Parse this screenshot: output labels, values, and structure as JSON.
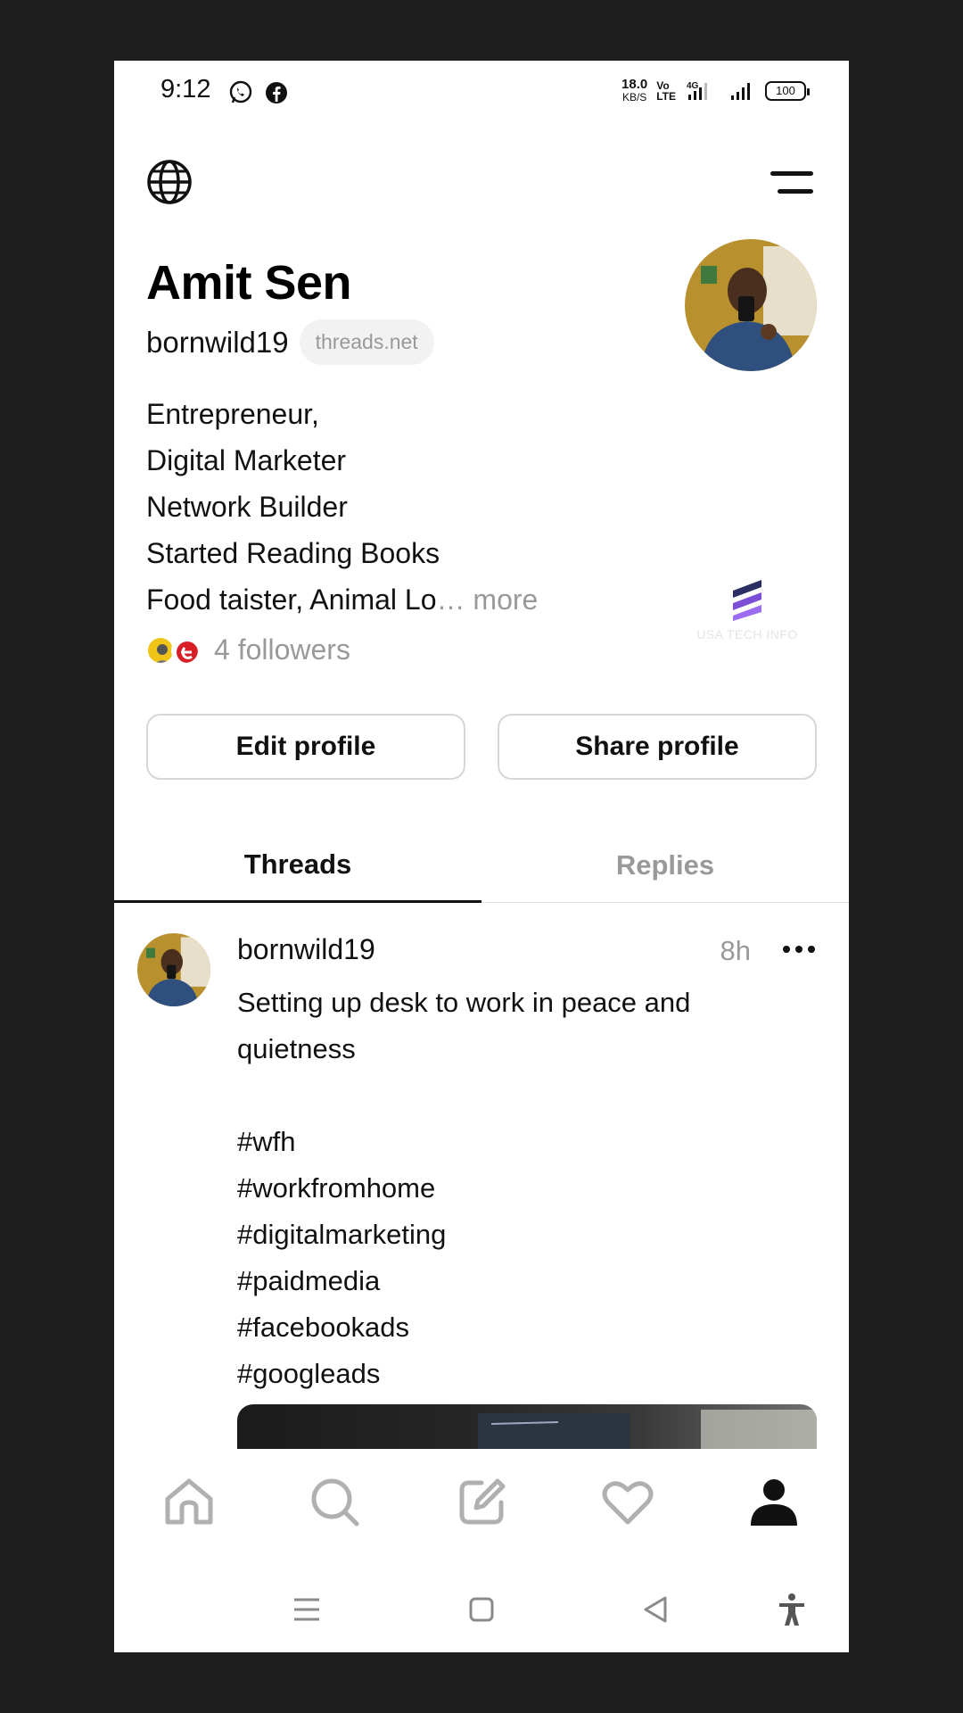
{
  "status_bar": {
    "time": "9:12",
    "net_speed": "18.0",
    "net_unit": "KB/S",
    "volte": "Vo",
    "volte2": "LTE",
    "network": "4G",
    "battery": "100"
  },
  "profile": {
    "name": "Amit Sen",
    "username": "bornwild19",
    "domain_chip": "threads.net",
    "bio_lines": [
      "Entrepreneur,",
      "Digital Marketer",
      "Network Builder",
      "Started Reading Books",
      "Food taister, Animal Lo"
    ],
    "bio_ellipsis": "…",
    "bio_more": " more",
    "followers_text": "4 followers"
  },
  "watermark": "USA TECH INFO",
  "buttons": {
    "edit": "Edit profile",
    "share": "Share profile"
  },
  "tabs": {
    "threads": "Threads",
    "replies": "Replies"
  },
  "post": {
    "username": "bornwild19",
    "time": "8h",
    "text_line1": "Setting up desk to work in peace and",
    "text_line2": "quietness",
    "hashtags": [
      "#wfh",
      "#workfromhome",
      "#digitalmarketing",
      "#paidmedia",
      "#facebookads",
      "#googleads"
    ]
  },
  "bottom_nav": [
    "home-icon",
    "search-icon",
    "compose-icon",
    "heart-icon",
    "profile-icon"
  ],
  "colors": {
    "text": "#111111",
    "muted": "#999999",
    "border": "#d6d6d6"
  }
}
